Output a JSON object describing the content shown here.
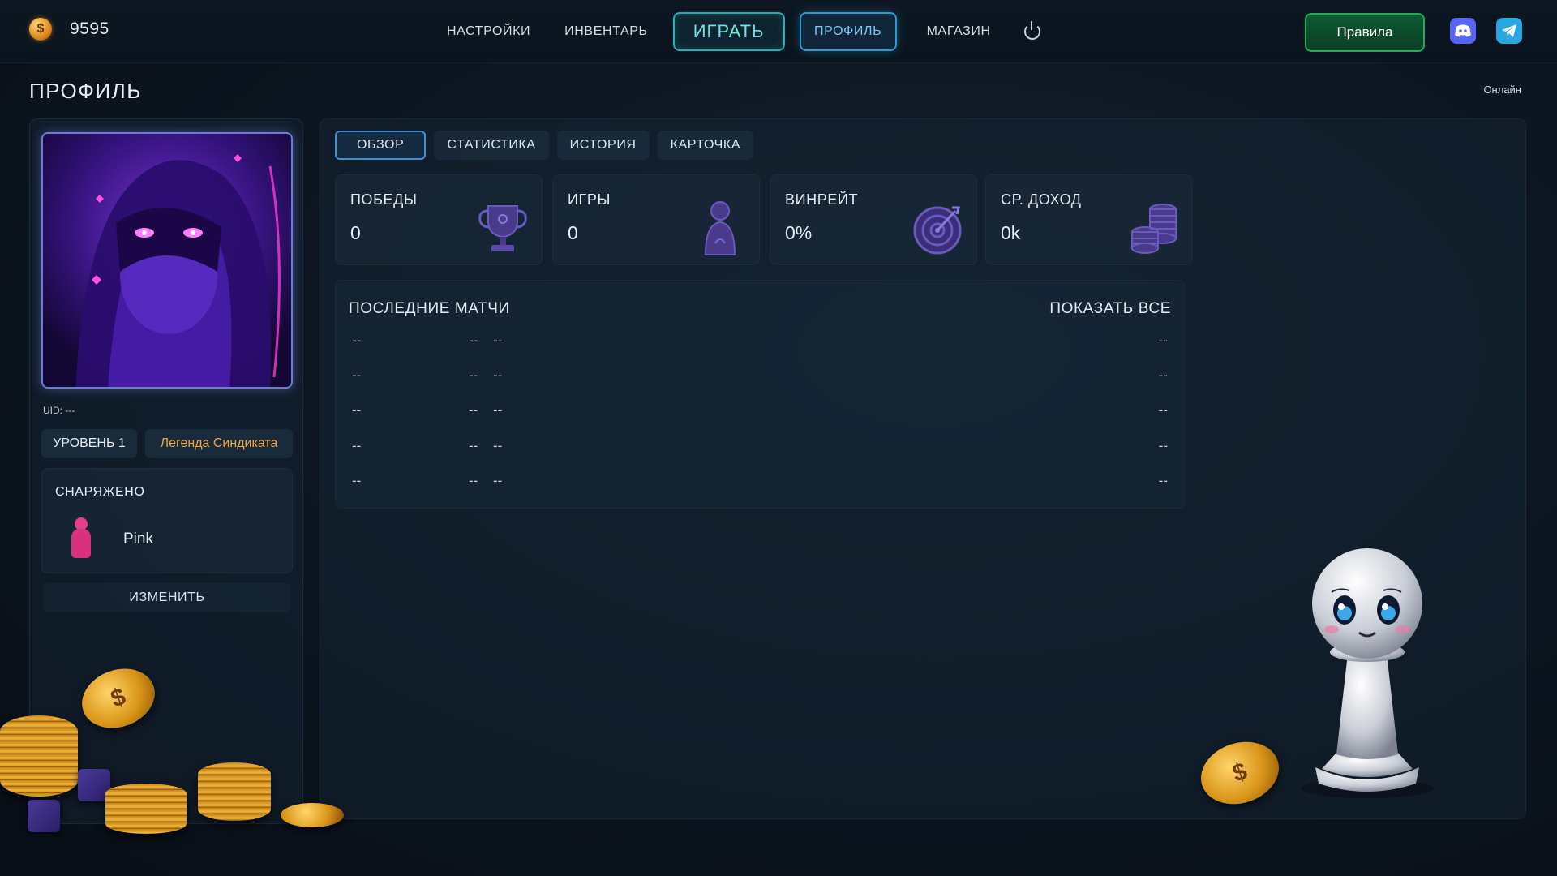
{
  "header": {
    "balance": "9595",
    "coin_symbol": "$",
    "nav": {
      "settings": "НАСТРОЙКИ",
      "inventory": "ИНВЕНТАРЬ",
      "play": "ИГРАТЬ",
      "profile": "ПРОФИЛЬ",
      "shop": "МАГАЗИН"
    },
    "rules": "Правила"
  },
  "page": {
    "title": "ПРОФИЛЬ",
    "status": "Онлайн"
  },
  "profile": {
    "uid": "UID: ---",
    "level": "УРОВЕНЬ 1",
    "rank_title": "Легенда Синдиката",
    "equipped_title": "СНАРЯЖЕНО",
    "equipped_item": "Pink",
    "change_label": "ИЗМЕНИТЬ"
  },
  "tabs": [
    "ОБЗОР",
    "СТАТИСТИКА",
    "ИСТОРИЯ",
    "КАРТОЧКА"
  ],
  "stats": [
    {
      "label": "ПОБЕДЫ",
      "value": "0",
      "icon": "trophy-icon"
    },
    {
      "label": "ИГРЫ",
      "value": "0",
      "icon": "player-icon"
    },
    {
      "label": "ВИНРЕЙТ",
      "value": "0%",
      "icon": "target-icon"
    },
    {
      "label": "СР. ДОХОД",
      "value": "0k",
      "icon": "coins-icon"
    }
  ],
  "matches": {
    "title": "ПОСЛЕДНИЕ МАТЧИ",
    "show_all": "ПОКАЗАТЬ ВСЕ",
    "rows": [
      [
        "--",
        "--",
        "--",
        "--"
      ],
      [
        "--",
        "--",
        "--",
        "--"
      ],
      [
        "--",
        "--",
        "--",
        "--"
      ],
      [
        "--",
        "--",
        "--",
        "--"
      ],
      [
        "--",
        "--",
        "--",
        "--"
      ]
    ]
  },
  "colors": {
    "accent_cyan": "#1fb2b8",
    "accent_blue": "#2b9ad6",
    "rules_green": "#1fae55",
    "rank_orange": "#f0a43a",
    "pawn_pink": "#e63d8a"
  }
}
